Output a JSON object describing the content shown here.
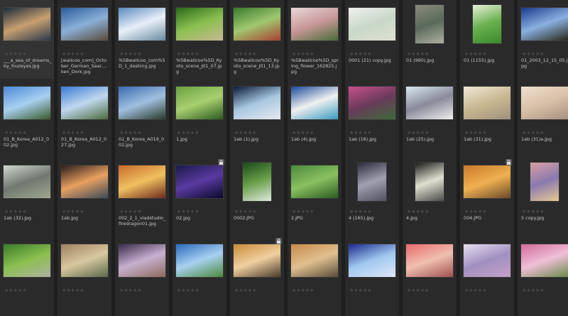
{
  "rating_glyph": "★★★★★",
  "items": [
    {
      "name": "___a_sea_of_dreams_by_foureyes.jpg",
      "colors": [
        "#1a2a3a",
        "#c8a070",
        "#2a3a4a"
      ],
      "ratio": "wide",
      "locked": false
    },
    {
      "name": "[wallcoo_com]_October_German_Saar....ken_Dork.jpg",
      "colors": [
        "#2a5a9a",
        "#8ab0d8",
        "#5a4a3a"
      ],
      "ratio": "wide",
      "locked": false
    },
    {
      "name": "%5Bwallcoo_com%5D_1_dashing.jpg",
      "colors": [
        "#5a8ac0",
        "#e8f0f8",
        "#6a8aa0"
      ],
      "ratio": "wide",
      "locked": false
    },
    {
      "name": "%5Bwallcoo%5D_Kyoto_scene_J01_07.jpg",
      "colors": [
        "#2a6a1a",
        "#8ac050",
        "#c8b890"
      ],
      "ratio": "wide",
      "locked": false
    },
    {
      "name": "%5Bwallcoo%5D_Kyoto_scene_J01_13.jpg",
      "colors": [
        "#3a7a2a",
        "#a0c870",
        "#a84030"
      ],
      "ratio": "wide",
      "locked": false
    },
    {
      "name": "%5Bwallcoo%5D_spring_flower_162825.jpg",
      "colors": [
        "#e8d8d8",
        "#c89898",
        "#4a6a3a"
      ],
      "ratio": "wide",
      "locked": false
    },
    {
      "name": "0001 (21) copy.jpg",
      "colors": [
        "#f0f0f0",
        "#c8d8c8",
        "#e0e0d0"
      ],
      "ratio": "wide",
      "locked": false
    },
    {
      "name": "01 (960).jpg",
      "colors": [
        "#8a8a7a",
        "#5a6a5a",
        "#b0b0a0"
      ],
      "ratio": "tall",
      "locked": false
    },
    {
      "name": "01 (1155).jpg",
      "colors": [
        "#e8f0d8",
        "#6ab050",
        "#3a8a2a"
      ],
      "ratio": "tall",
      "locked": false
    },
    {
      "name": "01_2003_12_15_05.jpg",
      "colors": [
        "#1a3a8a",
        "#8ab0e0",
        "#2a2a1a"
      ],
      "ratio": "wide",
      "locked": false
    },
    {
      "name": "01_B_Korea_A012_002.jpg",
      "colors": [
        "#4a8ad8",
        "#a8d0f0",
        "#3a5a2a"
      ],
      "ratio": "wide",
      "locked": false
    },
    {
      "name": "01_B_Korea_A012_027.jpg",
      "colors": [
        "#3a7ad0",
        "#c0d8f0",
        "#4a6a3a"
      ],
      "ratio": "wide",
      "locked": false
    },
    {
      "name": "01_B_Korea_A019_002.jpg",
      "colors": [
        "#3a6ab0",
        "#a0c0e0",
        "#2a3a2a"
      ],
      "ratio": "wide",
      "locked": false
    },
    {
      "name": "1.jpg",
      "colors": [
        "#6aa040",
        "#a8d070",
        "#2a5a20"
      ],
      "ratio": "wide",
      "locked": false
    },
    {
      "name": "1ab (1).jpg",
      "colors": [
        "#0a1a3a",
        "#a8c8e0",
        "#e8e8f0"
      ],
      "ratio": "wide",
      "locked": false
    },
    {
      "name": "1ab (4).jpg",
      "colors": [
        "#1a4a9a",
        "#f0f0f0",
        "#3a9ac0"
      ],
      "ratio": "wide",
      "locked": false
    },
    {
      "name": "1ab (16).jpg",
      "colors": [
        "#c8508a",
        "#6a3a5a",
        "#3a6a3a"
      ],
      "ratio": "wide",
      "locked": false
    },
    {
      "name": "1ab (25).jpg",
      "colors": [
        "#d8e8f0",
        "#8a8a9a",
        "#f0f0f0"
      ],
      "ratio": "wide",
      "locked": false
    },
    {
      "name": "1ab (31).jpg",
      "colors": [
        "#f0e8d8",
        "#c8b890",
        "#a09080"
      ],
      "ratio": "wide",
      "locked": false
    },
    {
      "name": "1ab (31)a.jpg",
      "colors": [
        "#f0e0d0",
        "#d8c0a8",
        "#a89080"
      ],
      "ratio": "wide",
      "locked": false
    },
    {
      "name": "1ab (32).jpg",
      "colors": [
        "#d0d8d0",
        "#707870",
        "#a0a890"
      ],
      "ratio": "wide",
      "locked": false
    },
    {
      "name": "1ab.jpg",
      "colors": [
        "#2a1a1a",
        "#e8a060",
        "#3a4a5a"
      ],
      "ratio": "wide",
      "locked": false
    },
    {
      "name": "002_2_1_vladstudio_firedragon01.jpg",
      "colors": [
        "#c86a2a",
        "#f0c060",
        "#6a2a1a"
      ],
      "ratio": "wide",
      "locked": false
    },
    {
      "name": "02.jpg",
      "colors": [
        "#1a1a4a",
        "#5a3aa0",
        "#0a0a2a"
      ],
      "ratio": "wide",
      "locked": true
    },
    {
      "name": "0002.JPG",
      "colors": [
        "#1a4a1a",
        "#6aa04a",
        "#e0e8e0"
      ],
      "ratio": "tall",
      "locked": false
    },
    {
      "name": "2.JPG",
      "colors": [
        "#4a8a3a",
        "#8ac060",
        "#2a5a20"
      ],
      "ratio": "wide",
      "locked": false
    },
    {
      "name": "4 (165).jpg",
      "colors": [
        "#2a2a3a",
        "#a0a0b0",
        "#505060"
      ],
      "ratio": "tall",
      "locked": false
    },
    {
      "name": "4.jpg",
      "colors": [
        "#1a1a1a",
        "#e0e0d0",
        "#4a4a4a"
      ],
      "ratio": "tall",
      "locked": false
    },
    {
      "name": "004.JPG",
      "colors": [
        "#c87a2a",
        "#f0b050",
        "#6a4a2a"
      ],
      "ratio": "wide",
      "locked": true
    },
    {
      "name": "5 copy.jpg",
      "colors": [
        "#d8a0a0",
        "#8a7ab0",
        "#e8c890"
      ],
      "ratio": "tall",
      "locked": false
    },
    {
      "name": "",
      "colors": [
        "#3a7a2a",
        "#8ac050",
        "#b0b0a0"
      ],
      "ratio": "wide",
      "locked": false
    },
    {
      "name": "",
      "colors": [
        "#a08060",
        "#d8c8a0",
        "#5a6a4a"
      ],
      "ratio": "wide",
      "locked": false
    },
    {
      "name": "",
      "colors": [
        "#3a2a4a",
        "#c8b0d0",
        "#8a6a5a"
      ],
      "ratio": "wide",
      "locked": false
    },
    {
      "name": "",
      "colors": [
        "#2a6ac0",
        "#a8d0f0",
        "#4a8a3a"
      ],
      "ratio": "wide",
      "locked": false
    },
    {
      "name": "",
      "colors": [
        "#c88a3a",
        "#f0d0a0",
        "#4a3a2a"
      ],
      "ratio": "wide",
      "locked": true
    },
    {
      "name": "",
      "colors": [
        "#c88a4a",
        "#e0c090",
        "#5a4a3a"
      ],
      "ratio": "wide",
      "locked": false
    },
    {
      "name": "",
      "colors": [
        "#1a2a8a",
        "#a0c8f0",
        "#e0e8f8"
      ],
      "ratio": "wide",
      "locked": false
    },
    {
      "name": "",
      "colors": [
        "#e86a6a",
        "#f0c0b0",
        "#a05050"
      ],
      "ratio": "wide",
      "locked": false
    },
    {
      "name": "",
      "colors": [
        "#e8e0f0",
        "#a090c0",
        "#c8a0c8"
      ],
      "ratio": "wide",
      "locked": false
    },
    {
      "name": "",
      "colors": [
        "#d06a9a",
        "#f0c0d8",
        "#6a8a4a"
      ],
      "ratio": "wide",
      "locked": false
    }
  ]
}
